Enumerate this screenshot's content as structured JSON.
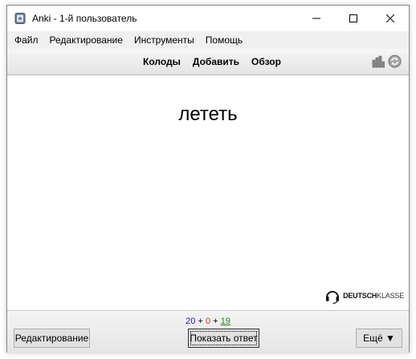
{
  "window": {
    "title": "Anki - 1-й пользователь"
  },
  "menu": {
    "items": [
      "Файл",
      "Редактирование",
      "Инструменты",
      "Помощь"
    ]
  },
  "toolbar": {
    "links": [
      "Колоды",
      "Добавить",
      "Обзор"
    ],
    "icons": [
      "stats-icon",
      "sync-icon"
    ]
  },
  "card": {
    "front": "лететь"
  },
  "logo": {
    "bold": "DEUTSCH",
    "thin": "KLASSE",
    "icon": "headset-icon"
  },
  "counts": {
    "new": "20",
    "sep1": "+",
    "learning": "0",
    "sep2": "+",
    "review": "19",
    "colors": {
      "new": "#1c1c9e",
      "learning": "#c0392b",
      "review": "#1e7b1e"
    }
  },
  "buttons": {
    "edit": "Редактирование",
    "show_answer": "Показать ответ",
    "more": "Ещё ▼"
  }
}
